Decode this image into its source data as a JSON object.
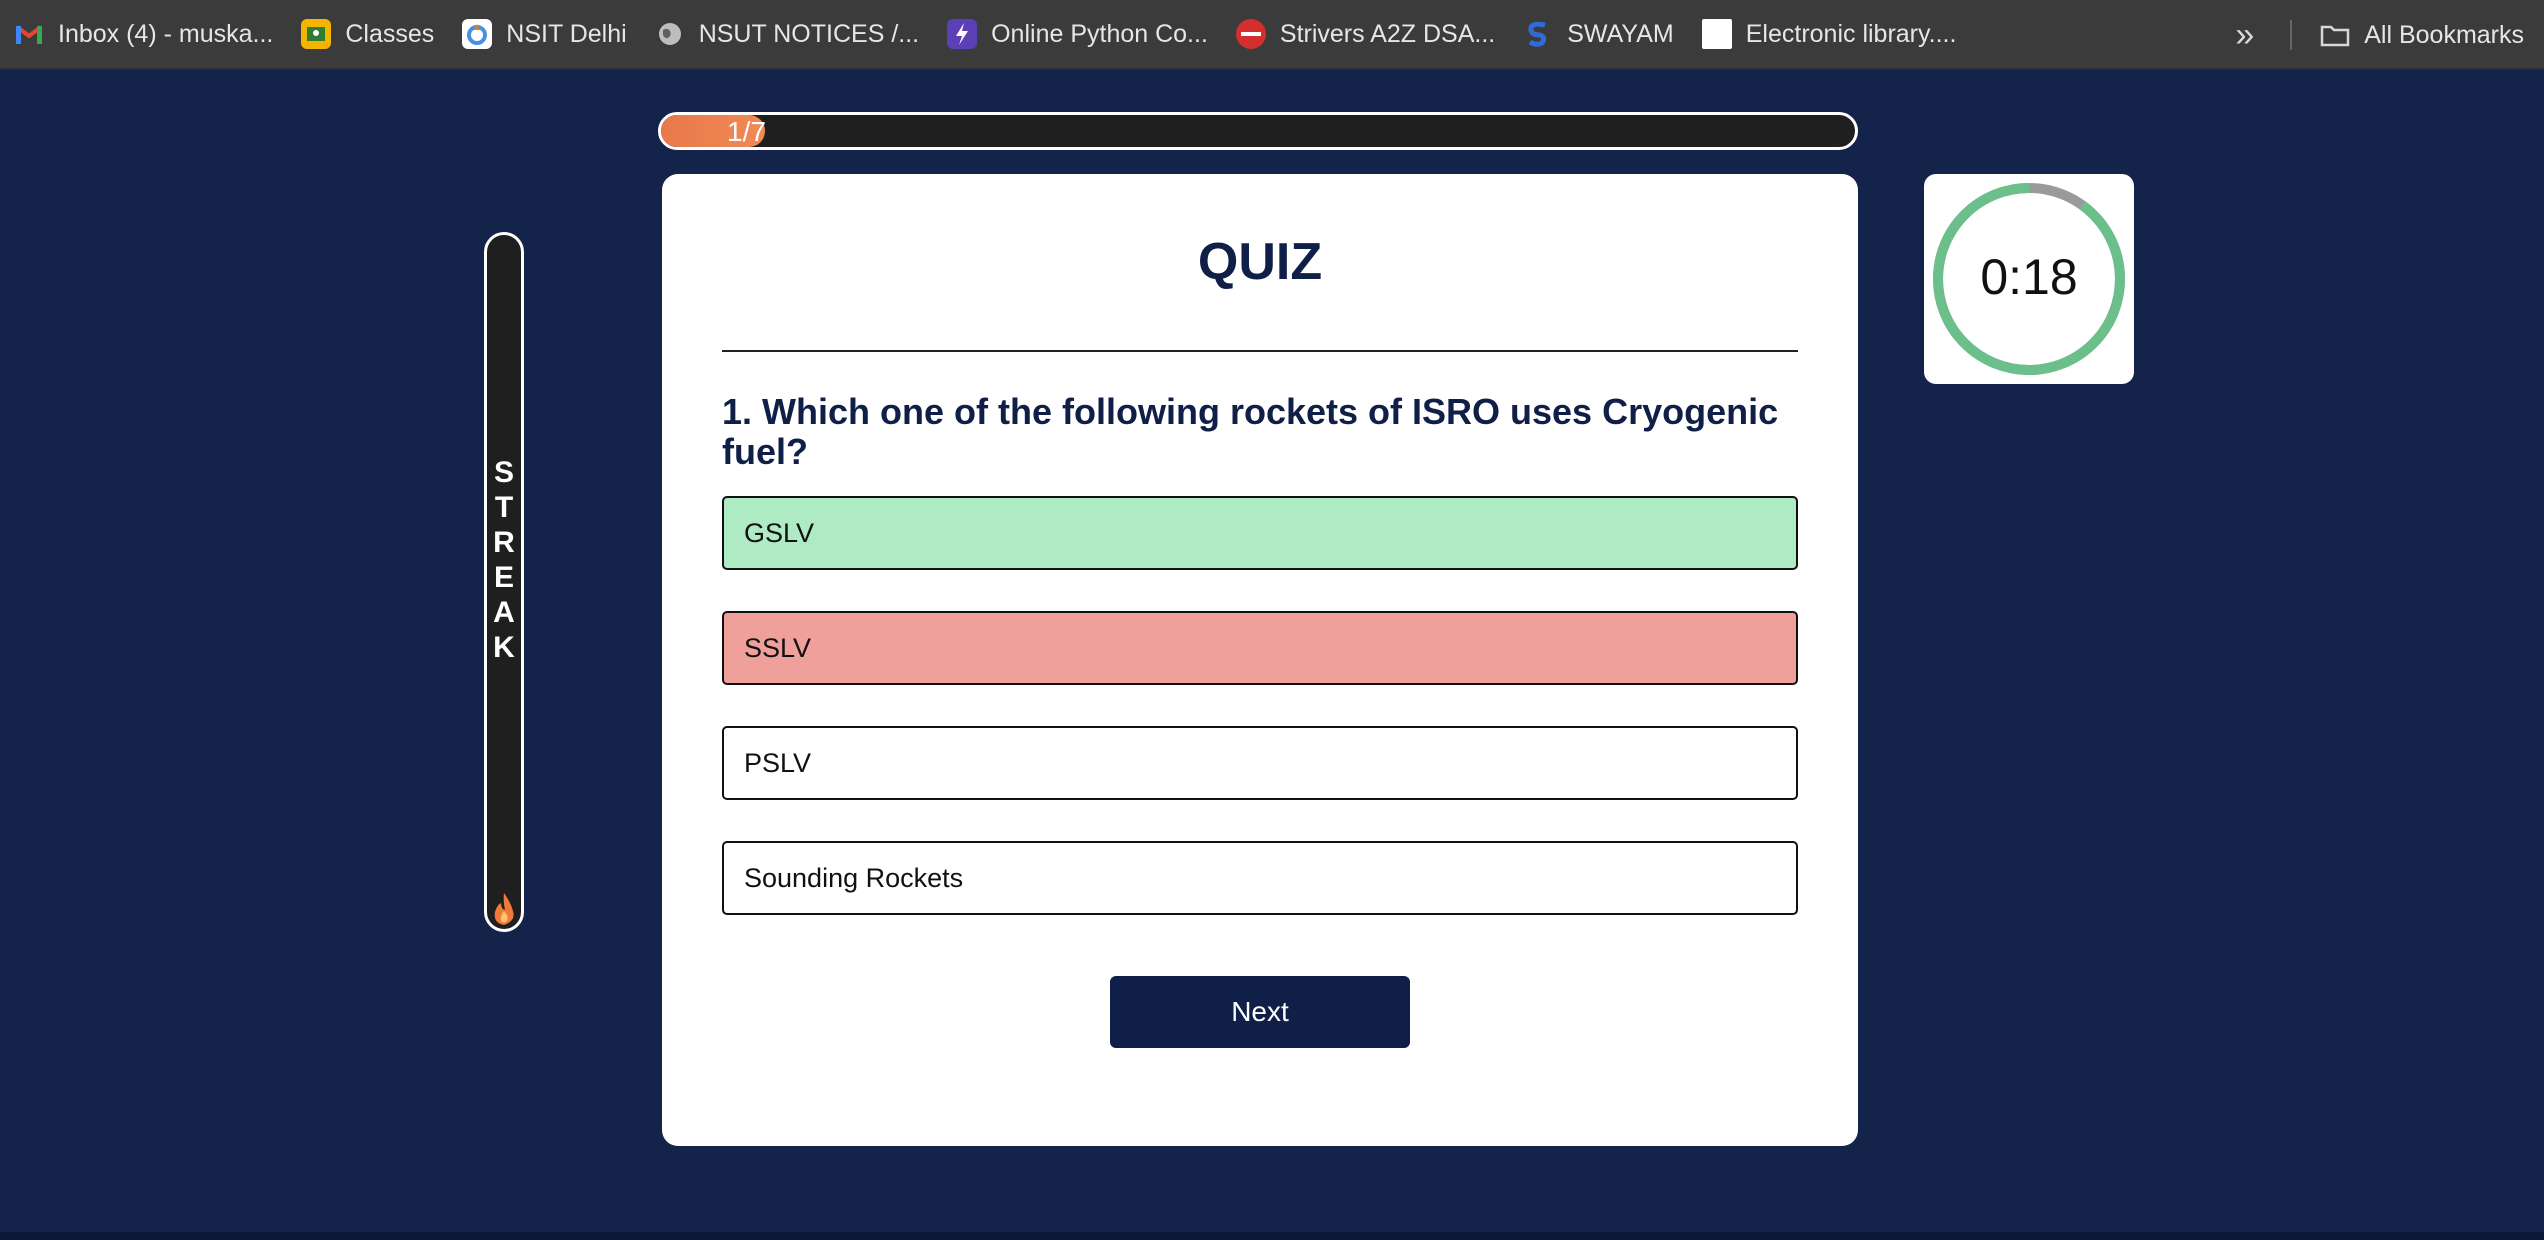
{
  "bookmarks": [
    {
      "label": "Inbox (4) - muska...",
      "icon": "gmail-icon",
      "color": "#ea4335"
    },
    {
      "label": "Classes",
      "icon": "classroom-icon",
      "color": "#f4b400"
    },
    {
      "label": "NSIT Delhi",
      "icon": "nsit-logo-icon",
      "color": "#4a90e2"
    },
    {
      "label": "NSUT NOTICES /...",
      "icon": "globe-icon",
      "color": "#bdbdbd"
    },
    {
      "label": "Online Python Co...",
      "icon": "bolt-icon",
      "color": "#5a3fb5"
    },
    {
      "label": "Strivers A2Z DSA...",
      "icon": "tuf-icon",
      "color": "#d32f2f"
    },
    {
      "label": "SWAYAM",
      "icon": "swayam-icon",
      "color": "#2f6bd6"
    },
    {
      "label": "Electronic library....",
      "icon": "blank-page-icon",
      "color": "#ffffff"
    }
  ],
  "bookmarks_right": {
    "label": "All Bookmarks"
  },
  "progress": {
    "label": "1/7",
    "fraction": 0.0875
  },
  "streak": {
    "label": "S\nT\nR\nE\nA\nK"
  },
  "quiz": {
    "title": "QUIZ",
    "question": "1. Which one of the following rockets of ISRO uses Cryogenic fuel?",
    "options": [
      {
        "label": "GSLV",
        "state": "correct",
        "color": "#aeeac3"
      },
      {
        "label": "SSLV",
        "state": "wrong",
        "color": "#f0a09b"
      },
      {
        "label": "PSLV",
        "state": "neutral",
        "color": "#ffffff"
      },
      {
        "label": "Sounding Rockets",
        "state": "neutral",
        "color": "#ffffff"
      }
    ],
    "next_label": "Next"
  },
  "timer": {
    "label": "0:18",
    "remaining_fraction": 0.9,
    "ring_color": "#6bbf8a",
    "track_color": "#9a9a9a"
  }
}
